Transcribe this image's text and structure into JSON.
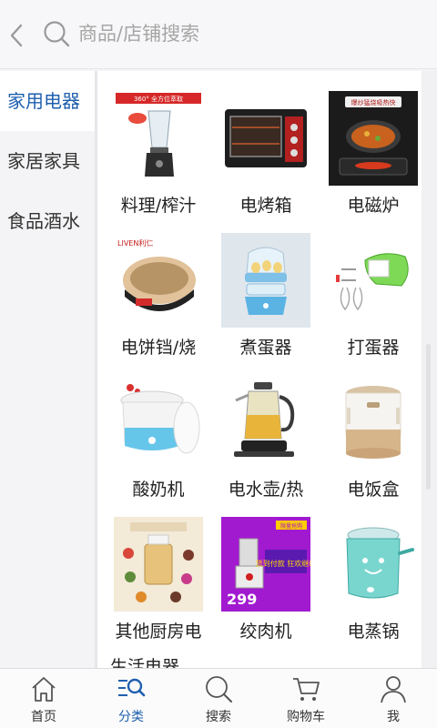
{
  "header": {
    "search_placeholder": "商品/店铺搜索"
  },
  "sidebar": {
    "items": [
      {
        "label": "家用电器"
      },
      {
        "label": "家居家具"
      },
      {
        "label": "食品酒水"
      }
    ]
  },
  "products": [
    {
      "name": "料理/榨汁",
      "thumb_badge": "360° 全方位萃取"
    },
    {
      "name": "电烤箱"
    },
    {
      "name": "电磁炉",
      "thumb_badge": "爆炒猛烧吸热快"
    },
    {
      "name": "电饼铛/烧",
      "thumb_badge": "LIVEN利仁"
    },
    {
      "name": "煮蛋器"
    },
    {
      "name": "打蛋器"
    },
    {
      "name": "酸奶机"
    },
    {
      "name": "电水壶/热"
    },
    {
      "name": "电饭盒"
    },
    {
      "name": "其他厨房电"
    },
    {
      "name": "绞肉机",
      "thumb_badge": "限量抢购",
      "thumb_price": "299",
      "thumb_promo": "货到付款 狂欢继续"
    },
    {
      "name": "电蒸锅"
    }
  ],
  "partial_item": "生活电器",
  "tabbar": {
    "items": [
      {
        "label": "首页",
        "icon": "home-icon"
      },
      {
        "label": "分类",
        "icon": "category-icon"
      },
      {
        "label": "搜索",
        "icon": "search-icon"
      },
      {
        "label": "购物车",
        "icon": "cart-icon"
      },
      {
        "label": "我",
        "icon": "user-icon"
      }
    ],
    "active_color": "#1e5fae"
  },
  "colors": {
    "accent": "#1e5fae",
    "sidebar_bg": "#f4f4f6",
    "content_bg": "#ffffff"
  }
}
